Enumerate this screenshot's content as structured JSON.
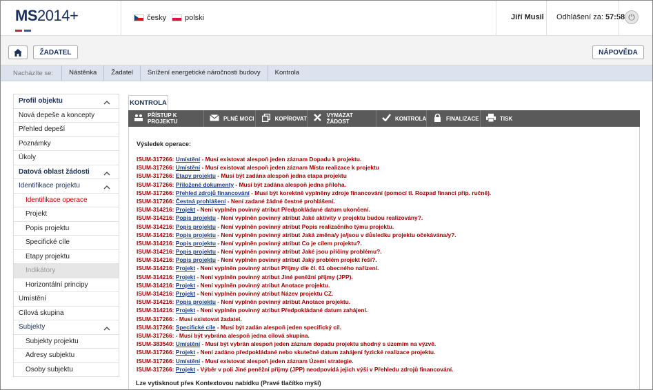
{
  "header": {
    "logo_main": "MS",
    "logo_year": "2014+",
    "languages": [
      {
        "label": "česky",
        "flag": "cz"
      },
      {
        "label": "polski",
        "flag": "pl"
      }
    ],
    "user_name": "Jiří Musil",
    "logout_label": "Odhlášení za:",
    "logout_time": "57:58",
    "colors": {
      "brand": "#1a2f5a",
      "accent_red": "#c0272d",
      "accent_blue": "#2a5caa"
    }
  },
  "toolbar2": {
    "home_icon": "home-icon",
    "applicant_label": "ŽADATEL",
    "help_label": "NÁPOVĚDA"
  },
  "breadcrumb": {
    "label": "Nacházíte se:",
    "items": [
      "Nástěnka",
      "Žadatel",
      "Snížení energetické náročnosti budovy",
      "Kontrola"
    ]
  },
  "sidebar": {
    "items": [
      {
        "label": "Profil objektu",
        "type": "head",
        "chevron": true
      },
      {
        "label": "Nová depeše a koncepty",
        "type": "item"
      },
      {
        "label": "Přehled depeší",
        "type": "item"
      },
      {
        "label": "Poznámky",
        "type": "item"
      },
      {
        "label": "Úkoly",
        "type": "item"
      },
      {
        "label": "Datová oblast žádosti",
        "type": "head",
        "chevron": true
      },
      {
        "label": "Identifikace projektu",
        "type": "plain-head",
        "chevron": true
      },
      {
        "label": "Identifikace operace",
        "type": "sub active"
      },
      {
        "label": "Projekt",
        "type": "sub"
      },
      {
        "label": "Popis projektu",
        "type": "sub"
      },
      {
        "label": "Specifické cíle",
        "type": "sub"
      },
      {
        "label": "Etapy projektu",
        "type": "sub"
      },
      {
        "label": "Indikátory",
        "type": "sub disabled"
      },
      {
        "label": "Horizontální principy",
        "type": "sub"
      },
      {
        "label": "Umístění",
        "type": "item"
      },
      {
        "label": "Cílová skupina",
        "type": "item"
      },
      {
        "label": "Subjekty",
        "type": "plain-head",
        "chevron": true
      },
      {
        "label": "Subjekty projektu",
        "type": "sub"
      },
      {
        "label": "Adresy subjektu",
        "type": "sub"
      },
      {
        "label": "Osoby subjektu",
        "type": "sub"
      }
    ]
  },
  "main": {
    "tab_label": "KONTROLA",
    "actions": [
      {
        "label": "PŘÍSTUP K PROJEKTU",
        "icon": "people-icon",
        "width": 110
      },
      {
        "label": "PLNÉ MOCI",
        "icon": "envelope-icon",
        "width": 75
      },
      {
        "label": "KOPÍROVAT",
        "icon": "copy-icon",
        "width": 75
      },
      {
        "label": "VYMAZAT ŽÁDOST",
        "icon": "x-icon",
        "width": 100
      },
      {
        "label": "KONTROLA",
        "icon": "check-icon",
        "width": 73
      },
      {
        "label": "FINALIZACE",
        "icon": "lock-icon",
        "width": 78
      },
      {
        "label": "TISK",
        "icon": "print-icon",
        "width": 231
      }
    ],
    "result_title": "Výsledek operace:",
    "errors": [
      {
        "code": "ISUM-317266:",
        "link": "Umístění",
        "text": " - Musí existovat alespoň jeden záznam Dopadu k projektu."
      },
      {
        "code": "ISUM-317266:",
        "link": "Umístění",
        "text": " - Musí existovat alespoň jeden záznam Místa realizace k projektu"
      },
      {
        "code": "ISUM-317266:",
        "link": "Etapy projektu",
        "text": " - Musí být zadána alespoň jedna etapa projektu"
      },
      {
        "code": "ISUM-317266:",
        "link": "Přiložené dokumenty",
        "text": " - Musí být zadána alespoň jedna příloha."
      },
      {
        "code": "ISUM-317266:",
        "link": "Přehled zdrojů financování",
        "text": " - Musí být korektně vyplněny zdroje financování (pomocí tl. Rozpad financí příp. ručně)."
      },
      {
        "code": "ISUM-317266:",
        "link": "Čestná prohlášení",
        "text": " - Není zadané žádné čestné prohlášení."
      },
      {
        "code": "ISUM-314216:",
        "link": "Projekt",
        "text": " - Není vyplněn povinný atribut Předpokládané datum ukončení."
      },
      {
        "code": "ISUM-314216:",
        "link": "Popis projektu",
        "text": " - Není vyplněn povinný atribut Jaké aktivity v projektu budou realizovány?."
      },
      {
        "code": "ISUM-314216:",
        "link": "Popis projektu",
        "text": " - Není vyplněn povinný atribut Popis realizačního týmu projektu."
      },
      {
        "code": "ISUM-314216:",
        "link": "Popis projektu",
        "text": " - Není vyplněn povinný atribut Jaká změna/y je/jsou v důsledku projektu očekávána/y?."
      },
      {
        "code": "ISUM-314216:",
        "link": "Popis projektu",
        "text": " - Není vyplněn povinný atribut Co je cílem projektu?."
      },
      {
        "code": "ISUM-314216:",
        "link": "Popis projektu",
        "text": " - Není vyplněn povinný atribut Jaké jsou příčiny problému?."
      },
      {
        "code": "ISUM-314216:",
        "link": "Popis projektu",
        "text": " - Není vyplněn povinný atribut Jaký problém projekt řeší?."
      },
      {
        "code": "ISUM-314216:",
        "link": "Projekt",
        "text": " - Není vyplněn povinný atribut Příjmy dle čl. 61 obecného nařízení."
      },
      {
        "code": "ISUM-314216:",
        "link": "Projekt",
        "text": " - Není vyplněn povinný atribut Jiné peněžní příjmy (JPP)."
      },
      {
        "code": "ISUM-314216:",
        "link": "Projekt",
        "text": " - Není vyplněn povinný atribut Anotace projektu."
      },
      {
        "code": "ISUM-314216:",
        "link": "Projekt",
        "text": " - Není vyplněn povinný atribut Název projektu CZ."
      },
      {
        "code": "ISUM-314216:",
        "link": "Popis projektu",
        "text": " - Není vyplněn povinný atribut Anotace projektu."
      },
      {
        "code": "ISUM-314216:",
        "link": "Projekt",
        "text": " - Není vyplněn povinný atribut Předpokládané datum zahájení."
      },
      {
        "code": "ISUM-317266:",
        "link": "",
        "text": " - Musí existovat žadatel."
      },
      {
        "code": "ISUM-317266:",
        "link": "Specifické cíle",
        "text": " - Musí být zadán alespoň jeden specifický cíl."
      },
      {
        "code": "ISUM-317266:",
        "link": "",
        "text": " - Musí být vybrána alespoň jedna cílová skupina."
      },
      {
        "code": "ISUM-383540:",
        "link": "Umístění",
        "text": " - Musí být vybrán alespoň jeden záznam dopadu projektu shodný s územím na výzvě."
      },
      {
        "code": "ISUM-317266:",
        "link": "Projekt",
        "text": " - Není zadáno předpokládané nebo skutečné datum zahájení fyzické realizace projektu."
      },
      {
        "code": "ISUM-317266:",
        "link": "Umístění",
        "text": " - Musí existovat alespoň jeden záznam Území strategie."
      },
      {
        "code": "ISUM-317266:",
        "link": "Projekt",
        "text": " - Výběr v poli Jiné peněžní příjmy (JPP) neodpovídá jejich výši v Přehledu zdrojů financování."
      }
    ],
    "footnote": "Lze vytisknout přes Kontextovou nabídku (Pravé tlačítko myši)"
  }
}
